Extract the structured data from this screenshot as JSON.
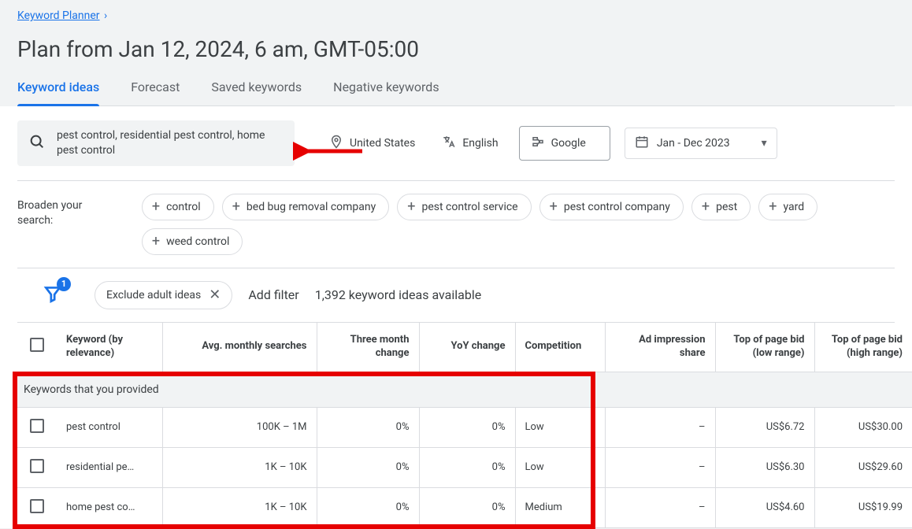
{
  "breadcrumb": {
    "label": "Keyword Planner"
  },
  "page_title": "Plan from Jan 12, 2024, 6 am, GMT-05:00",
  "tabs": [
    {
      "label": "Keyword ideas",
      "active": true
    },
    {
      "label": "Forecast"
    },
    {
      "label": "Saved keywords"
    },
    {
      "label": "Negative keywords"
    }
  ],
  "search": {
    "query": "pest control, residential pest control, home pest control",
    "location": "United States",
    "language": "English",
    "network": "Google",
    "date_range": "Jan - Dec 2023"
  },
  "broaden": {
    "label": "Broaden your search:",
    "chips": [
      "control",
      "bed bug removal company",
      "pest control service",
      "pest control company",
      "pest",
      "yard",
      "weed control"
    ]
  },
  "filters": {
    "badge": "1",
    "exclude_label": "Exclude adult ideas",
    "add_filter_label": "Add filter",
    "count_text": "1,392 keyword ideas available"
  },
  "columns": {
    "keyword": "Keyword (by relevance)",
    "avg": "Avg. monthly searches",
    "three_month": "Three month change",
    "yoy": "YoY change",
    "competition": "Competition",
    "ad_share": "Ad impression share",
    "bid_low": "Top of page bid (low range)",
    "bid_high": "Top of page bid (high range)"
  },
  "group_header": "Keywords that you provided",
  "rows": [
    {
      "keyword": "pest control",
      "avg": "100K – 1M",
      "three_month": "0%",
      "yoy": "0%",
      "competition": "Low",
      "ad_share": "–",
      "bid_low": "US$6.72",
      "bid_high": "US$30.00"
    },
    {
      "keyword": "residential pe…",
      "avg": "1K – 10K",
      "three_month": "0%",
      "yoy": "0%",
      "competition": "Low",
      "ad_share": "–",
      "bid_low": "US$6.30",
      "bid_high": "US$29.60"
    },
    {
      "keyword": "home pest co…",
      "avg": "1K – 10K",
      "three_month": "0%",
      "yoy": "0%",
      "competition": "Medium",
      "ad_share": "–",
      "bid_low": "US$4.60",
      "bid_high": "US$19.99"
    }
  ]
}
